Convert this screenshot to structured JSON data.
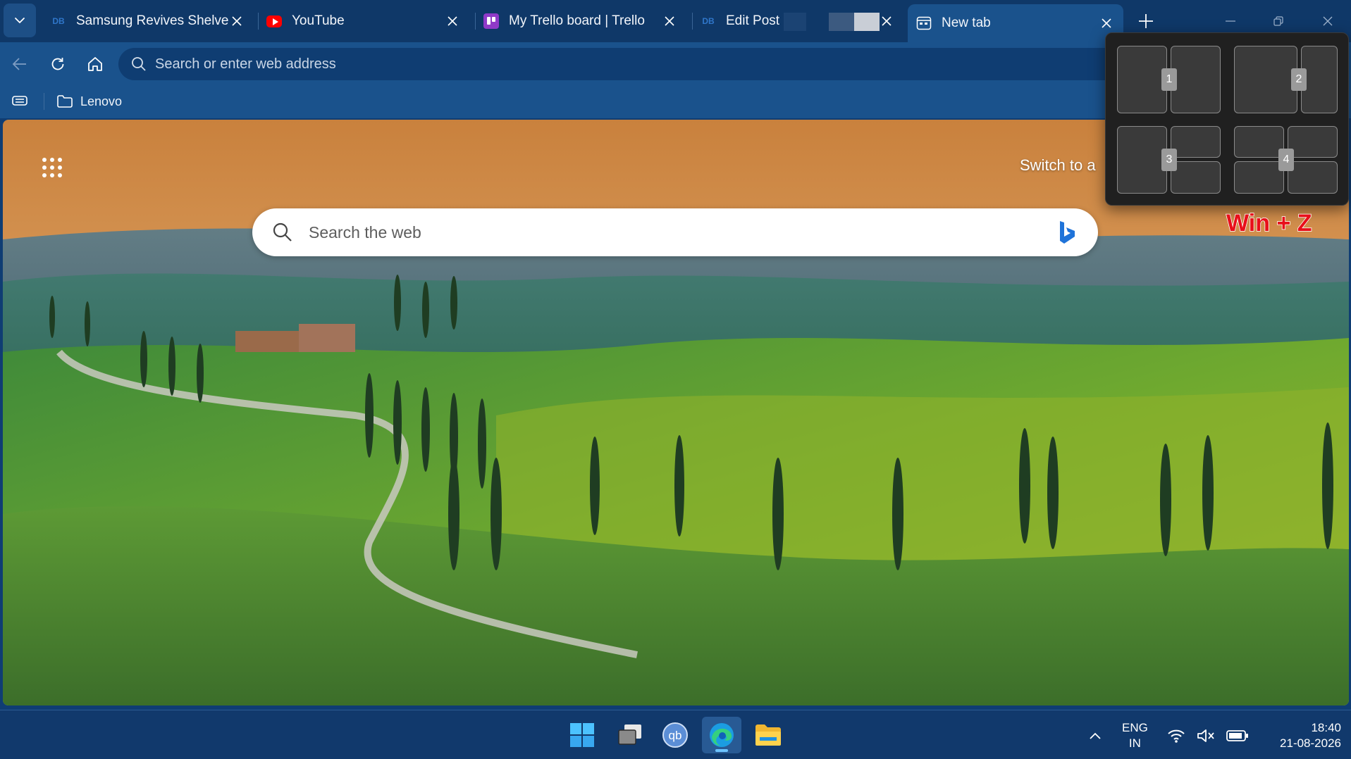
{
  "tabs": [
    {
      "title": "Samsung Revives Shelved O",
      "favicon": "db-favicon"
    },
    {
      "title": "YouTube",
      "favicon": "youtube-favicon"
    },
    {
      "title": "My Trello board | Trello",
      "favicon": "trello-favicon"
    },
    {
      "title": "Edit Post “",
      "favicon": "db-favicon"
    },
    {
      "title": "New tab",
      "favicon": "newtab-favicon",
      "active": true
    }
  ],
  "favicon_db_text": "DB",
  "address_bar": {
    "placeholder": "Search or enter web address"
  },
  "favorites_bar": {
    "folder": "Lenovo"
  },
  "newtab_page": {
    "search_placeholder": "Search the web",
    "switch_text": "Switch to a"
  },
  "snap_layouts": {
    "zones": [
      "1",
      "2",
      "3",
      "4"
    ]
  },
  "shortcut_label": "Win + Z",
  "taskbar": {
    "lang_top": "ENG",
    "lang_bottom": "IN",
    "time": "18:40",
    "date": "21-08-2026"
  },
  "colors": {
    "tabstrip": "#0f3868",
    "toolbar": "#1a528c",
    "taskbar": "#11396c",
    "shortcut_red": "#e8101a",
    "snap_bg": "#202020"
  }
}
